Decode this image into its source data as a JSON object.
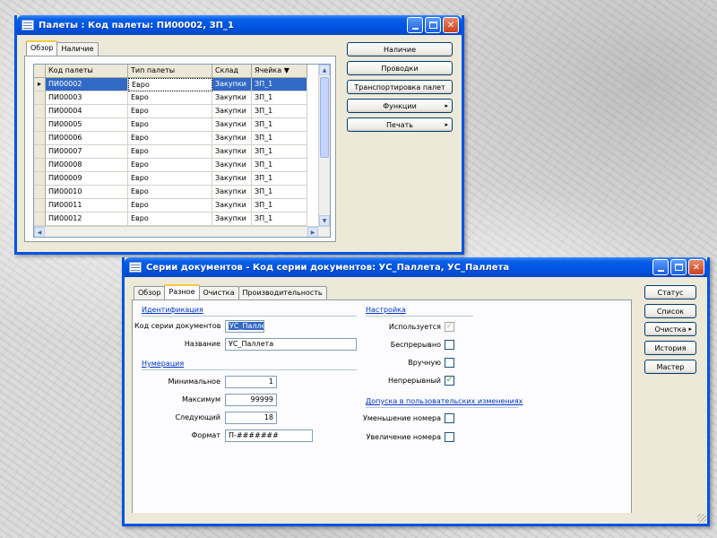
{
  "window1": {
    "title": "Палеты : Код палеты: ПИ00002, ЗП_1",
    "tabs": [
      "Обзор",
      "Наличие"
    ],
    "grid": {
      "columns": [
        "Код палеты",
        "Тип палеты",
        "Склад",
        "Ячейка"
      ],
      "sort_indicator": "▼",
      "row_marker": "▸",
      "rows": [
        [
          "ПИ00002",
          "Евро",
          "Закупки",
          "ЗП_1"
        ],
        [
          "ПИ00003",
          "Евро",
          "Закупки",
          "ЗП_1"
        ],
        [
          "ПИ00004",
          "Евро",
          "Закупки",
          "ЗП_1"
        ],
        [
          "ПИ00005",
          "Евро",
          "Закупки",
          "ЗП_1"
        ],
        [
          "ПИ00006",
          "Евро",
          "Закупки",
          "ЗП_1"
        ],
        [
          "ПИ00007",
          "Евро",
          "Закупки",
          "ЗП_1"
        ],
        [
          "ПИ00008",
          "Евро",
          "Закупки",
          "ЗП_1"
        ],
        [
          "ПИ00009",
          "Евро",
          "Закупки",
          "ЗП_1"
        ],
        [
          "ПИ00010",
          "Евро",
          "Закупки",
          "ЗП_1"
        ],
        [
          "ПИ00011",
          "Евро",
          "Закупки",
          "ЗП_1"
        ],
        [
          "ПИ00012",
          "Евро",
          "Закупки",
          "ЗП_1"
        ]
      ]
    },
    "buttons": {
      "nalichie": "Наличие",
      "provodki": "Проводки",
      "transport": "Транспортировка палет",
      "funkcii": "Функции",
      "pechat": "Печать"
    }
  },
  "window2": {
    "title": "Серии документов - Код серии документов: УС_Паллета, УС_Паллета",
    "tabs": [
      "Обзор",
      "Разное",
      "Очистка",
      "Производительность"
    ],
    "sections": {
      "identification": "Идентификация",
      "numbering": "Нумерация",
      "setup": "Настройка",
      "user_changes": "Допуска в пользовательских изменениях"
    },
    "fields": {
      "code_label": "Код серии документов",
      "code_value": "УС_Паллета",
      "name_label": "Название",
      "name_value": "УС_Паллета",
      "min_label": "Минимальное",
      "min_value": "1",
      "max_label": "Максимум",
      "max_value": "99999",
      "next_label": "Следующий",
      "next_value": "18",
      "format_label": "Формат",
      "format_value": "П-#######"
    },
    "checkboxes": {
      "in_use": "Используется",
      "continuous": "Беспрерывно",
      "manual": "Вручную",
      "continuous2": "Непрерывный",
      "decrease": "Уменьшение номера",
      "increase": "Увеличение номера"
    },
    "check_mark": "✓",
    "buttons": {
      "status": "Статус",
      "list": "Список",
      "cleanup": "Очистка",
      "history": "История",
      "wizard": "Мастер"
    }
  },
  "icons": {
    "submenu_arrow": "▸",
    "scroll_up": "▲",
    "scroll_down": "▼",
    "scroll_left": "◀",
    "scroll_right": "▶",
    "close": "✕"
  },
  "colors": {
    "titlebar": "#0054e3",
    "selection": "#316ac5",
    "window_bg": "#ece9d8",
    "section_text": "#0033cc"
  }
}
